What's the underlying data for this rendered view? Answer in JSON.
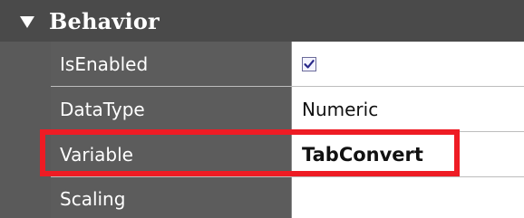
{
  "section": {
    "title": "Behavior",
    "expand_icon": "triangle-down-icon"
  },
  "properties": [
    {
      "name": "IsEnabled",
      "value": "",
      "type": "checkbox",
      "checked": true
    },
    {
      "name": "DataType",
      "value": "Numeric",
      "type": "text"
    },
    {
      "name": "Variable",
      "value": "TabConvert",
      "type": "text",
      "highlighted": true
    },
    {
      "name": "Scaling",
      "value": "",
      "type": "text"
    }
  ],
  "colors": {
    "header_bg": "#4a4a4a",
    "name_cell_bg": "#5c5c5c",
    "highlight": "#ee1c24"
  }
}
